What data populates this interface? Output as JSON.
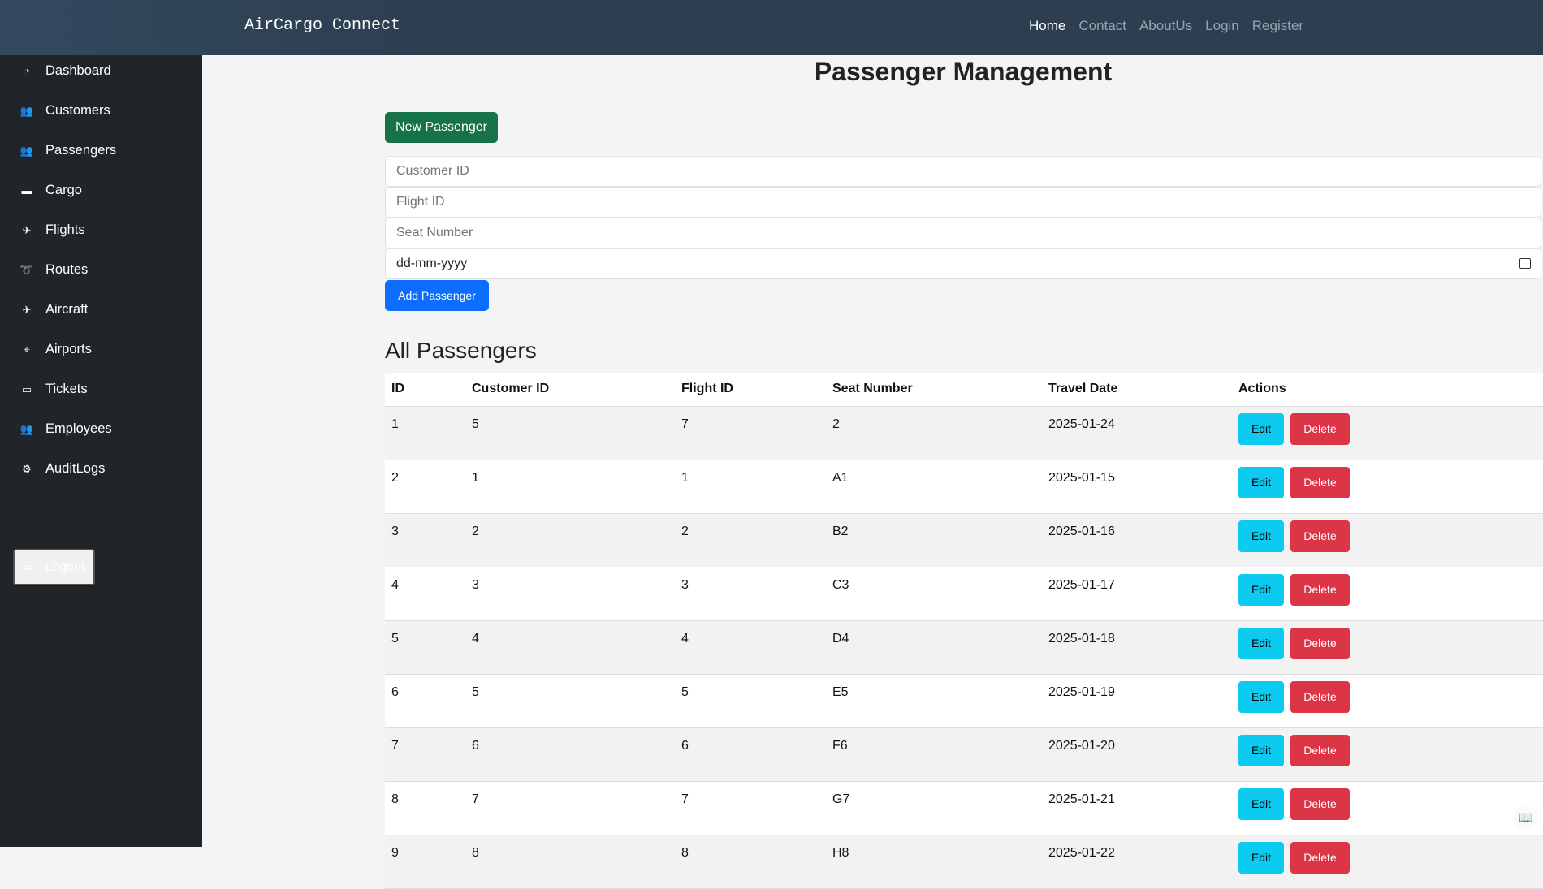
{
  "header": {
    "brand": "AirCargo Connect",
    "nav": [
      "Home",
      "Contact",
      "AboutUs",
      "Login",
      "Register"
    ]
  },
  "sidebar": {
    "items": [
      {
        "label": "Dashboard",
        "icon": "gauge-icon"
      },
      {
        "label": "Customers",
        "icon": "users-icon"
      },
      {
        "label": "Passengers",
        "icon": "users-icon"
      },
      {
        "label": "Cargo",
        "icon": "box-icon"
      },
      {
        "label": "Flights",
        "icon": "plane-icon"
      },
      {
        "label": "Routes",
        "icon": "route-icon"
      },
      {
        "label": "Aircraft",
        "icon": "plane-icon"
      },
      {
        "label": "Airports",
        "icon": "map-icon"
      },
      {
        "label": "Tickets",
        "icon": "ticket-icon"
      },
      {
        "label": "Employees",
        "icon": "users-icon"
      },
      {
        "label": "AuditLogs",
        "icon": "gear-icon"
      }
    ],
    "logout": "Logout"
  },
  "main": {
    "title": "Passenger Management",
    "new_button": "New Passenger",
    "form": {
      "customer_placeholder": "Customer ID",
      "flight_placeholder": "Flight ID",
      "seat_placeholder": "Seat Number",
      "date_value": "dd-mm-yyyy",
      "add_button": "Add Passenger"
    },
    "list_title": "All Passengers",
    "table": {
      "columns": [
        "ID",
        "Customer ID",
        "Flight ID",
        "Seat Number",
        "Travel Date",
        "Actions"
      ],
      "edit_label": "Edit",
      "delete_label": "Delete",
      "rows": [
        [
          "1",
          "5",
          "7",
          "2",
          "2025-01-24"
        ],
        [
          "2",
          "1",
          "1",
          "A1",
          "2025-01-15"
        ],
        [
          "3",
          "2",
          "2",
          "B2",
          "2025-01-16"
        ],
        [
          "4",
          "3",
          "3",
          "C3",
          "2025-01-17"
        ],
        [
          "5",
          "4",
          "4",
          "D4",
          "2025-01-18"
        ],
        [
          "6",
          "5",
          "5",
          "E5",
          "2025-01-19"
        ],
        [
          "7",
          "6",
          "6",
          "F6",
          "2025-01-20"
        ],
        [
          "8",
          "7",
          "7",
          "G7",
          "2025-01-21"
        ],
        [
          "9",
          "8",
          "8",
          "H8",
          "2025-01-22"
        ]
      ]
    }
  }
}
